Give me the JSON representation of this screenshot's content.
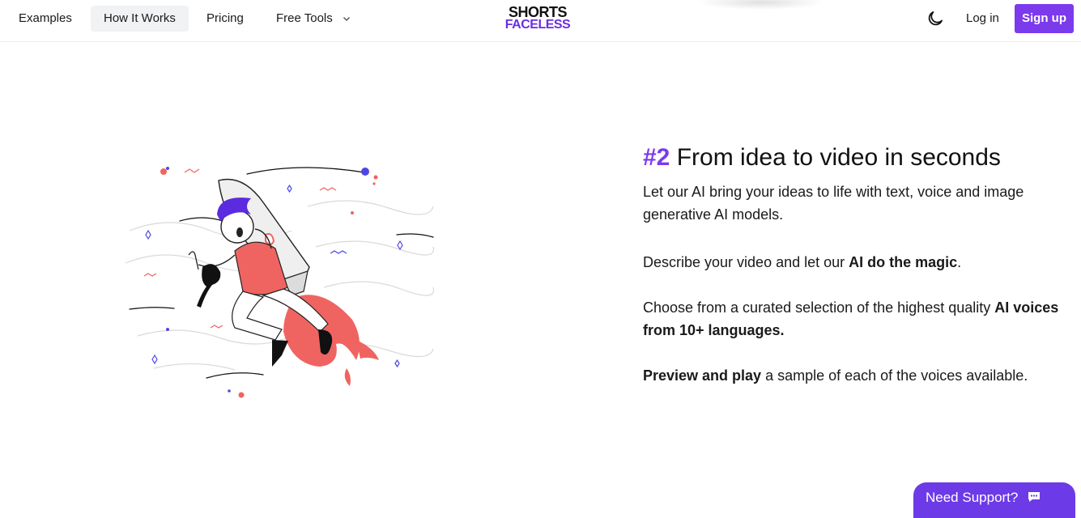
{
  "nav": {
    "items": [
      {
        "label": "Examples"
      },
      {
        "label": "How It Works",
        "active": true
      },
      {
        "label": "Pricing"
      },
      {
        "label": "Free Tools",
        "icon": "chevron-down-icon"
      }
    ]
  },
  "logo": {
    "line1": "SHORTS",
    "line2": "FACELESS"
  },
  "header_actions": {
    "theme_icon": "moon-icon",
    "login_label": "Log in",
    "signup_label": "Sign up"
  },
  "section": {
    "number": "#2",
    "title": "From idea to video in seconds",
    "p1": "Let our AI bring your ideas to life with text, voice and image generative AI models.",
    "p2": {
      "pre": "Describe your video and let our ",
      "bold": "AI do the magic",
      "post": "."
    },
    "p3": {
      "pre": "Choose from a curated selection of the highest quality ",
      "bold": "AI voices from 10+ languages."
    },
    "p4": {
      "bold": "Preview and play",
      "post": " a sample of each of the voices available."
    }
  },
  "illustration": {
    "icon": "rocket-person-illustration"
  },
  "support": {
    "label": "Need Support?",
    "icon": "chat-icon"
  },
  "colors": {
    "accent": "#7c3aed",
    "coral": "#ef6461",
    "indigo": "#4f46e5"
  }
}
